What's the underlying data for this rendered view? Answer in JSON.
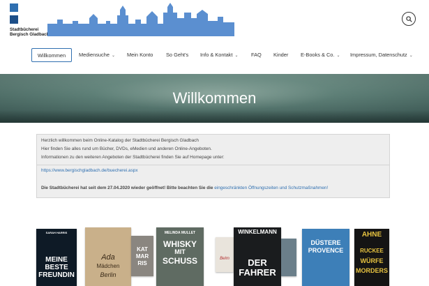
{
  "header": {
    "logo_line1": "Stadtbücherei",
    "logo_line2": "Bergisch Gladbach",
    "search_icon": "search-icon"
  },
  "nav": {
    "items": [
      {
        "label": "Willkommen",
        "dropdown": false,
        "active": true
      },
      {
        "label": "Mediensuche",
        "dropdown": true
      },
      {
        "label": "Mein Konto",
        "dropdown": false
      },
      {
        "label": "So Geht's",
        "dropdown": false
      },
      {
        "label": "Info & Kontakt",
        "dropdown": true
      },
      {
        "label": "FAQ",
        "dropdown": false
      },
      {
        "label": "Kinder",
        "dropdown": false
      },
      {
        "label": "E-Books & Co.",
        "dropdown": true
      },
      {
        "label": "Impressum, Datenschutz",
        "dropdown": true
      }
    ],
    "chevron": "⌄"
  },
  "hero": {
    "title": "Willkommen"
  },
  "info": {
    "line1": "Herzlich willkommen beim Online-Katalog der Stadtbücherei Bergisch Gladbach",
    "line2": "Hier finden Sie alles rund um Bücher, DVDs, eMedien und anderen Online-Angeboten.",
    "line3": "Informationen zu den weiteren Angeboten der Stadtbücherei finden Sie auf Homepage unter:",
    "link": "https://www.bergischgladbach.de/buecherei.aspx",
    "notice_bold": "Die Stadtbücherei hat seit dem 27.04.2020 wieder geöffnet! Bitte beachten Sie die",
    "notice_link": "eingeschränkten Öffnungszeiten und Schutzmaßnahmen!"
  },
  "books": [
    {
      "author": "SARAH HARRIS",
      "title1": "MEINE",
      "title2": "BESTE",
      "title3": "FREUNDIN",
      "bg": "#0e1a26",
      "fg": "#ffffff"
    },
    {
      "author": "",
      "title1": "Ada",
      "title2": "Mädchen",
      "title3": "Berlin",
      "bg": "#c9b08a",
      "fg": "#3a2a18"
    },
    {
      "author": "",
      "title1": "KAT",
      "title2": "MAR",
      "title3": "RIS",
      "bg": "#8a8680",
      "fg": "#ffffff"
    },
    {
      "author": "MELINDA MULLET",
      "title1": "WHISKY",
      "title2": "MIT",
      "title3": "SCHUSS",
      "bg": "#5f6b62",
      "fg": "#ffffff"
    },
    {
      "author": "",
      "title1": "Belm",
      "title2": "",
      "title3": "",
      "bg": "#e9e4dc",
      "fg": "#b33030"
    },
    {
      "author": "WINKELMANN",
      "title1": "DER",
      "title2": "FAHRER",
      "title3": "",
      "bg": "#1a1c1e",
      "fg": "#ffffff"
    },
    {
      "author": "",
      "title1": "",
      "title2": "",
      "title3": "",
      "bg": "#6b7f8a",
      "fg": "#ffffff"
    },
    {
      "author": "",
      "title1": "DÜSTERE",
      "title2": "PROVENCE",
      "title3": "",
      "bg": "#3d7fb8",
      "fg": "#ffffff"
    },
    {
      "author": "AHNE",
      "title1": "RUCKEE",
      "title2": "WÜRFE",
      "title3": "MORDERS",
      "bg": "#141414",
      "fg": "#e8c440"
    }
  ]
}
